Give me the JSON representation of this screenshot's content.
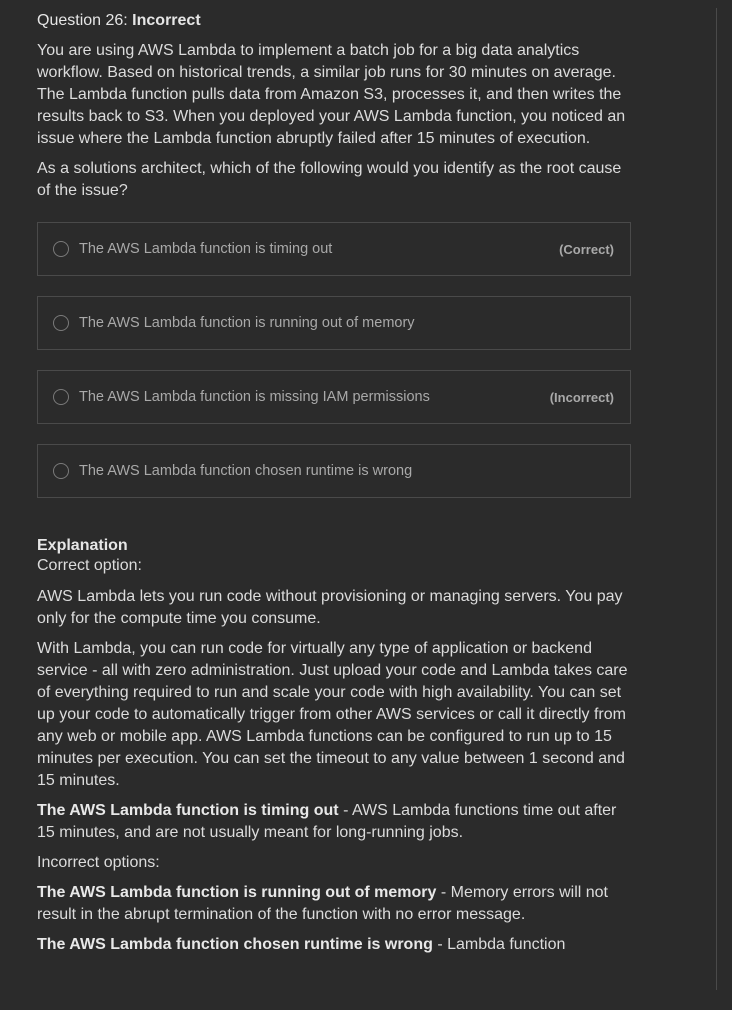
{
  "question": {
    "prefix": "Question 26: ",
    "status": "Incorrect",
    "paragraph1": "You are using AWS Lambda to implement a batch job for a big data analytics workflow. Based on historical trends, a similar job runs for 30 minutes on average. The Lambda function pulls data from Amazon S3, processes it, and then writes the results back to S3. When you deployed your AWS Lambda function, you noticed an issue where the Lambda function abruptly failed after 15 minutes of execution.",
    "paragraph2": "As a solutions architect, which of the following would you identify as the root cause of the issue?"
  },
  "options": [
    {
      "label": "The AWS Lambda function is timing out",
      "tag": "(Correct)"
    },
    {
      "label": "The AWS Lambda function is running out of memory",
      "tag": ""
    },
    {
      "label": "The AWS Lambda function is missing IAM permissions",
      "tag": "(Incorrect)"
    },
    {
      "label": "The AWS Lambda function chosen runtime is wrong",
      "tag": ""
    }
  ],
  "explanation": {
    "title": "Explanation",
    "correct_label": "Correct option:",
    "para1": "AWS Lambda lets you run code without provisioning or managing servers. You pay only for the compute time you consume.",
    "para2": "With Lambda, you can run code for virtually any type of application or backend service - all with zero administration. Just upload your code and Lambda takes care of everything required to run and scale your code with high availability. You can set up your code to automatically trigger from other AWS services or call it directly from any web or mobile app. AWS Lambda functions can be configured to run up to 15 minutes per execution. You can set the timeout to any value between 1 second and 15 minutes.",
    "correct_bold": "The AWS Lambda function is timing out",
    "correct_rest": " - AWS Lambda functions time out after 15 minutes, and are not usually meant for long-running jobs.",
    "incorrect_label": "Incorrect options:",
    "inc1_bold": "The AWS Lambda function is running out of memory",
    "inc1_rest": " - Memory errors will not result in the abrupt termination of the function with no error message.",
    "inc2_bold": "The AWS Lambda function chosen runtime is wrong",
    "inc2_rest": " - Lambda function"
  }
}
